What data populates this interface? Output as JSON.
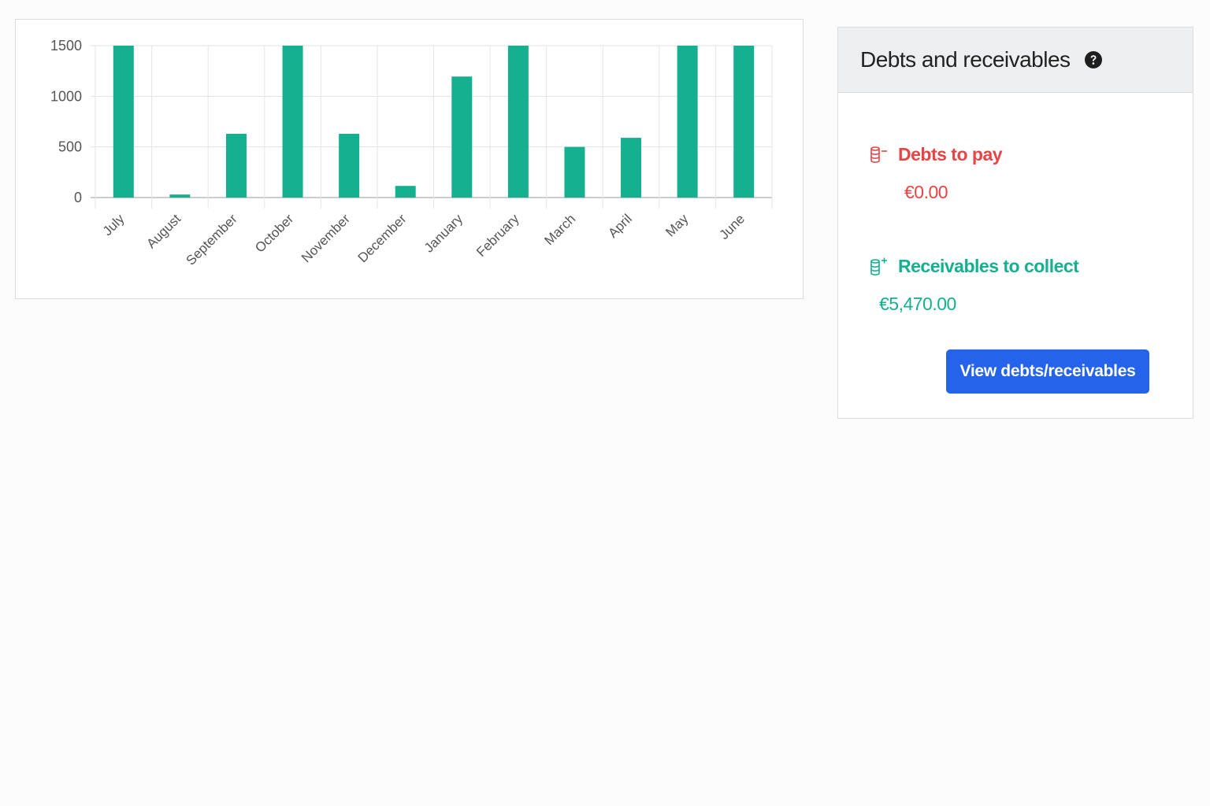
{
  "chart_data": {
    "type": "bar",
    "categories": [
      "July",
      "August",
      "September",
      "October",
      "November",
      "December",
      "January",
      "February",
      "March",
      "April",
      "May",
      "June"
    ],
    "values": [
      1500,
      30,
      630,
      1500,
      630,
      115,
      1195,
      1500,
      500,
      590,
      1500,
      1500
    ],
    "yticks": [
      0,
      500,
      1000,
      1500
    ],
    "ylim": [
      0,
      1500
    ],
    "grid": true,
    "bar_color": "#14b08f"
  },
  "summary": {
    "title": "Debts and receivables",
    "help_icon": "question-circle-icon",
    "debts": {
      "label": "Debts to pay",
      "value": "€0.00",
      "icon": "debt-coins-icon",
      "color": "#e74446"
    },
    "receivables": {
      "label": "Receivables to collect",
      "value": "€5,470.00",
      "icon": "receivable-coins-icon",
      "color": "#14b08f"
    },
    "button_label": "View debts/receivables",
    "button_color": "#2563eb"
  }
}
